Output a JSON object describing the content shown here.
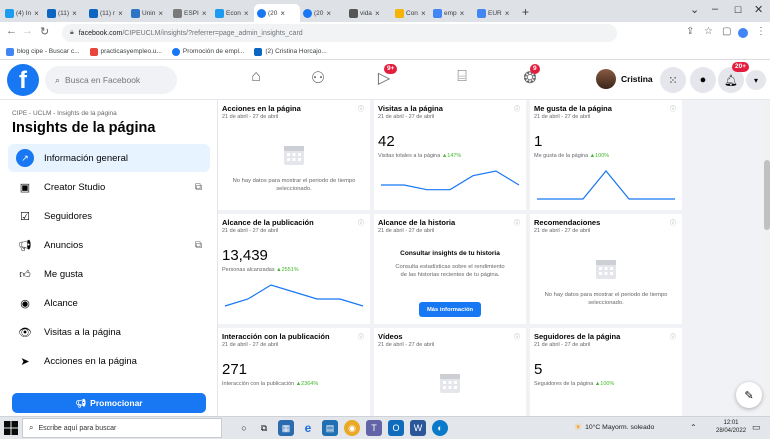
{
  "browser": {
    "tabs": [
      {
        "label": "(4) In",
        "color": "#1d9bf0"
      },
      {
        "label": "(11)",
        "color": "#0a66c2"
      },
      {
        "label": "(11) r",
        "color": "#0a66c2"
      },
      {
        "label": "Unin",
        "color": "#2d74c4"
      },
      {
        "label": "ESPI",
        "color": "#7a7a7a"
      },
      {
        "label": "Econ",
        "color": "#1d9bf0"
      },
      {
        "label": "(20",
        "color": "#1877f2"
      },
      {
        "label": "(20",
        "color": "#1877f2"
      },
      {
        "label": "vida",
        "color": "#555555"
      },
      {
        "label": "Con",
        "color": "#f4b400"
      },
      {
        "label": "emp",
        "color": "#4285f4"
      },
      {
        "label": "EUR",
        "color": "#4285f4"
      }
    ],
    "url_host": "facebook.com",
    "url_path": "/CIPEUCLM/insights/?referrer=page_admin_insights_card",
    "bookmarks": [
      {
        "label": "blog cipe - Buscar c...",
        "color": "#4285f4"
      },
      {
        "label": "practicasyempleo.u...",
        "color": "#e8453c"
      },
      {
        "label": "Promoción de empl...",
        "color": "#1877f2"
      },
      {
        "label": "(2) Cristina Horcajo...",
        "color": "#0a66c2"
      }
    ]
  },
  "fb": {
    "logo": "f",
    "search_placeholder": "Busca en Facebook",
    "nav_icons": [
      "home-icon",
      "friends-icon",
      "watch-icon",
      "marketplace-icon",
      "groups-icon"
    ],
    "watch_badge": "9+",
    "groups_badge": "9",
    "profile_name": "Cristina",
    "notif_badge": "20+"
  },
  "sidebar": {
    "breadcrumb": "CIPE - UCLM - Insights de la página",
    "title": "Insights de la página",
    "items": [
      {
        "label": "Información general",
        "icon": "overview-icon"
      },
      {
        "label": "Creator Studio",
        "icon": "creator-studio-icon"
      },
      {
        "label": "Seguidores",
        "icon": "followers-icon"
      },
      {
        "label": "Anuncios",
        "icon": "ads-icon"
      },
      {
        "label": "Me gusta",
        "icon": "like-icon"
      },
      {
        "label": "Alcance",
        "icon": "reach-icon"
      },
      {
        "label": "Visitas a la página",
        "icon": "eye-icon"
      },
      {
        "label": "Acciones en la página",
        "icon": "cursor-icon"
      }
    ],
    "promote_label": "Promocionar"
  },
  "cards": {
    "date_range": "21 de abril - 27 de abril",
    "actions": {
      "title": "Acciones en la página",
      "nodata": "No hay datos para mostrar el periodo de tiempo seleccionado."
    },
    "visits": {
      "title": "Visitas a la página",
      "value": "42",
      "sub": "Visitas totales a la página",
      "delta": "▲147%",
      "trend": [
        3,
        3,
        2,
        2,
        5,
        6,
        3
      ]
    },
    "likes": {
      "title": "Me gusta de la página",
      "value": "1",
      "sub": "Me gusta de la página",
      "delta": "▲100%",
      "trend": [
        0,
        0,
        0,
        1,
        0,
        0,
        0
      ]
    },
    "post_reach": {
      "title": "Alcance de la publicación",
      "value": "13,439",
      "sub": "Personas alcanzadas",
      "delta": "▲2551%",
      "trend": [
        1,
        2,
        4,
        3,
        2,
        2,
        1
      ]
    },
    "story_reach": {
      "title": "Alcance de la historia",
      "heading": "Consultar insights de tu historia",
      "desc": "Consulta estadísticas sobre el rendimiento de las historias recientes de tu página.",
      "button": "Más información"
    },
    "recommendations": {
      "title": "Recomendaciones",
      "nodata": "No hay datos para mostrar el periodo de tiempo seleccionado."
    },
    "post_engagement": {
      "title": "Interacción con la publicación",
      "value": "271",
      "sub": "Interacción con la publicación",
      "delta": "▲2364%"
    },
    "videos": {
      "title": "Vídeos"
    },
    "followers": {
      "title": "Seguidores de la página",
      "value": "5",
      "sub": "Seguidores de la página",
      "delta": "▲100%"
    }
  },
  "taskbar": {
    "search_placeholder": "Escribe aquí para buscar",
    "weather": "10°C  Mayorm. soleado",
    "time": "12:01",
    "date": "28/04/2022"
  },
  "colors": {
    "fb_blue": "#1877f2",
    "positive": "#42b72a",
    "chart_line": "#1877f2",
    "badge_red": "#e41e3f"
  }
}
